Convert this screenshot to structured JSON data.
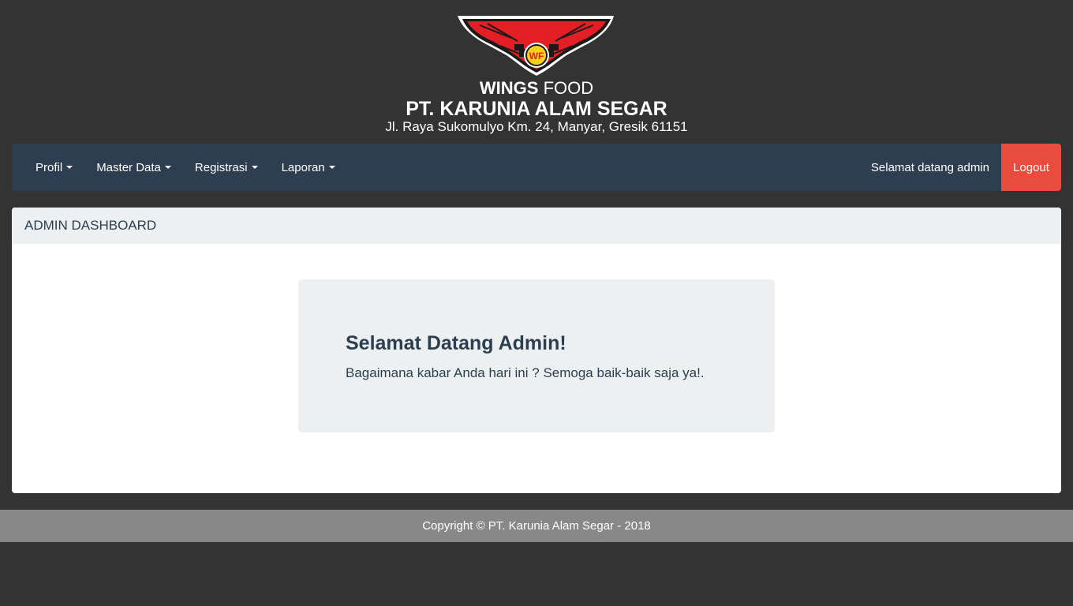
{
  "header": {
    "brand_bold": "WINGS",
    "brand_light": "FOOD",
    "company": "PT. KARUNIA ALAM SEGAR",
    "address": "Jl. Raya Sukomulyo Km. 24, Manyar, Gresik 61151",
    "logo_text": "WF"
  },
  "navbar": {
    "items": [
      {
        "label": "Profil"
      },
      {
        "label": "Master Data"
      },
      {
        "label": "Registrasi"
      },
      {
        "label": "Laporan"
      }
    ],
    "welcome": "Selamat datang admin",
    "logout": "Logout"
  },
  "panel": {
    "heading": "ADMIN DASHBOARD",
    "jumbotron": {
      "title": "Selamat Datang Admin!",
      "text": "Bagaimana kabar Anda hari ini ? Semoga baik-baik saja ya!."
    }
  },
  "footer": {
    "copyright": "Copyright © PT. Karunia Alam Segar - 2018"
  },
  "colors": {
    "background": "#333333",
    "navbar": "#2c3e50",
    "logout": "#e74c3c",
    "panel_heading": "#ecf0f1",
    "footer": "#888888",
    "logo_red": "#e31e24",
    "logo_yellow": "#f5d21a"
  }
}
